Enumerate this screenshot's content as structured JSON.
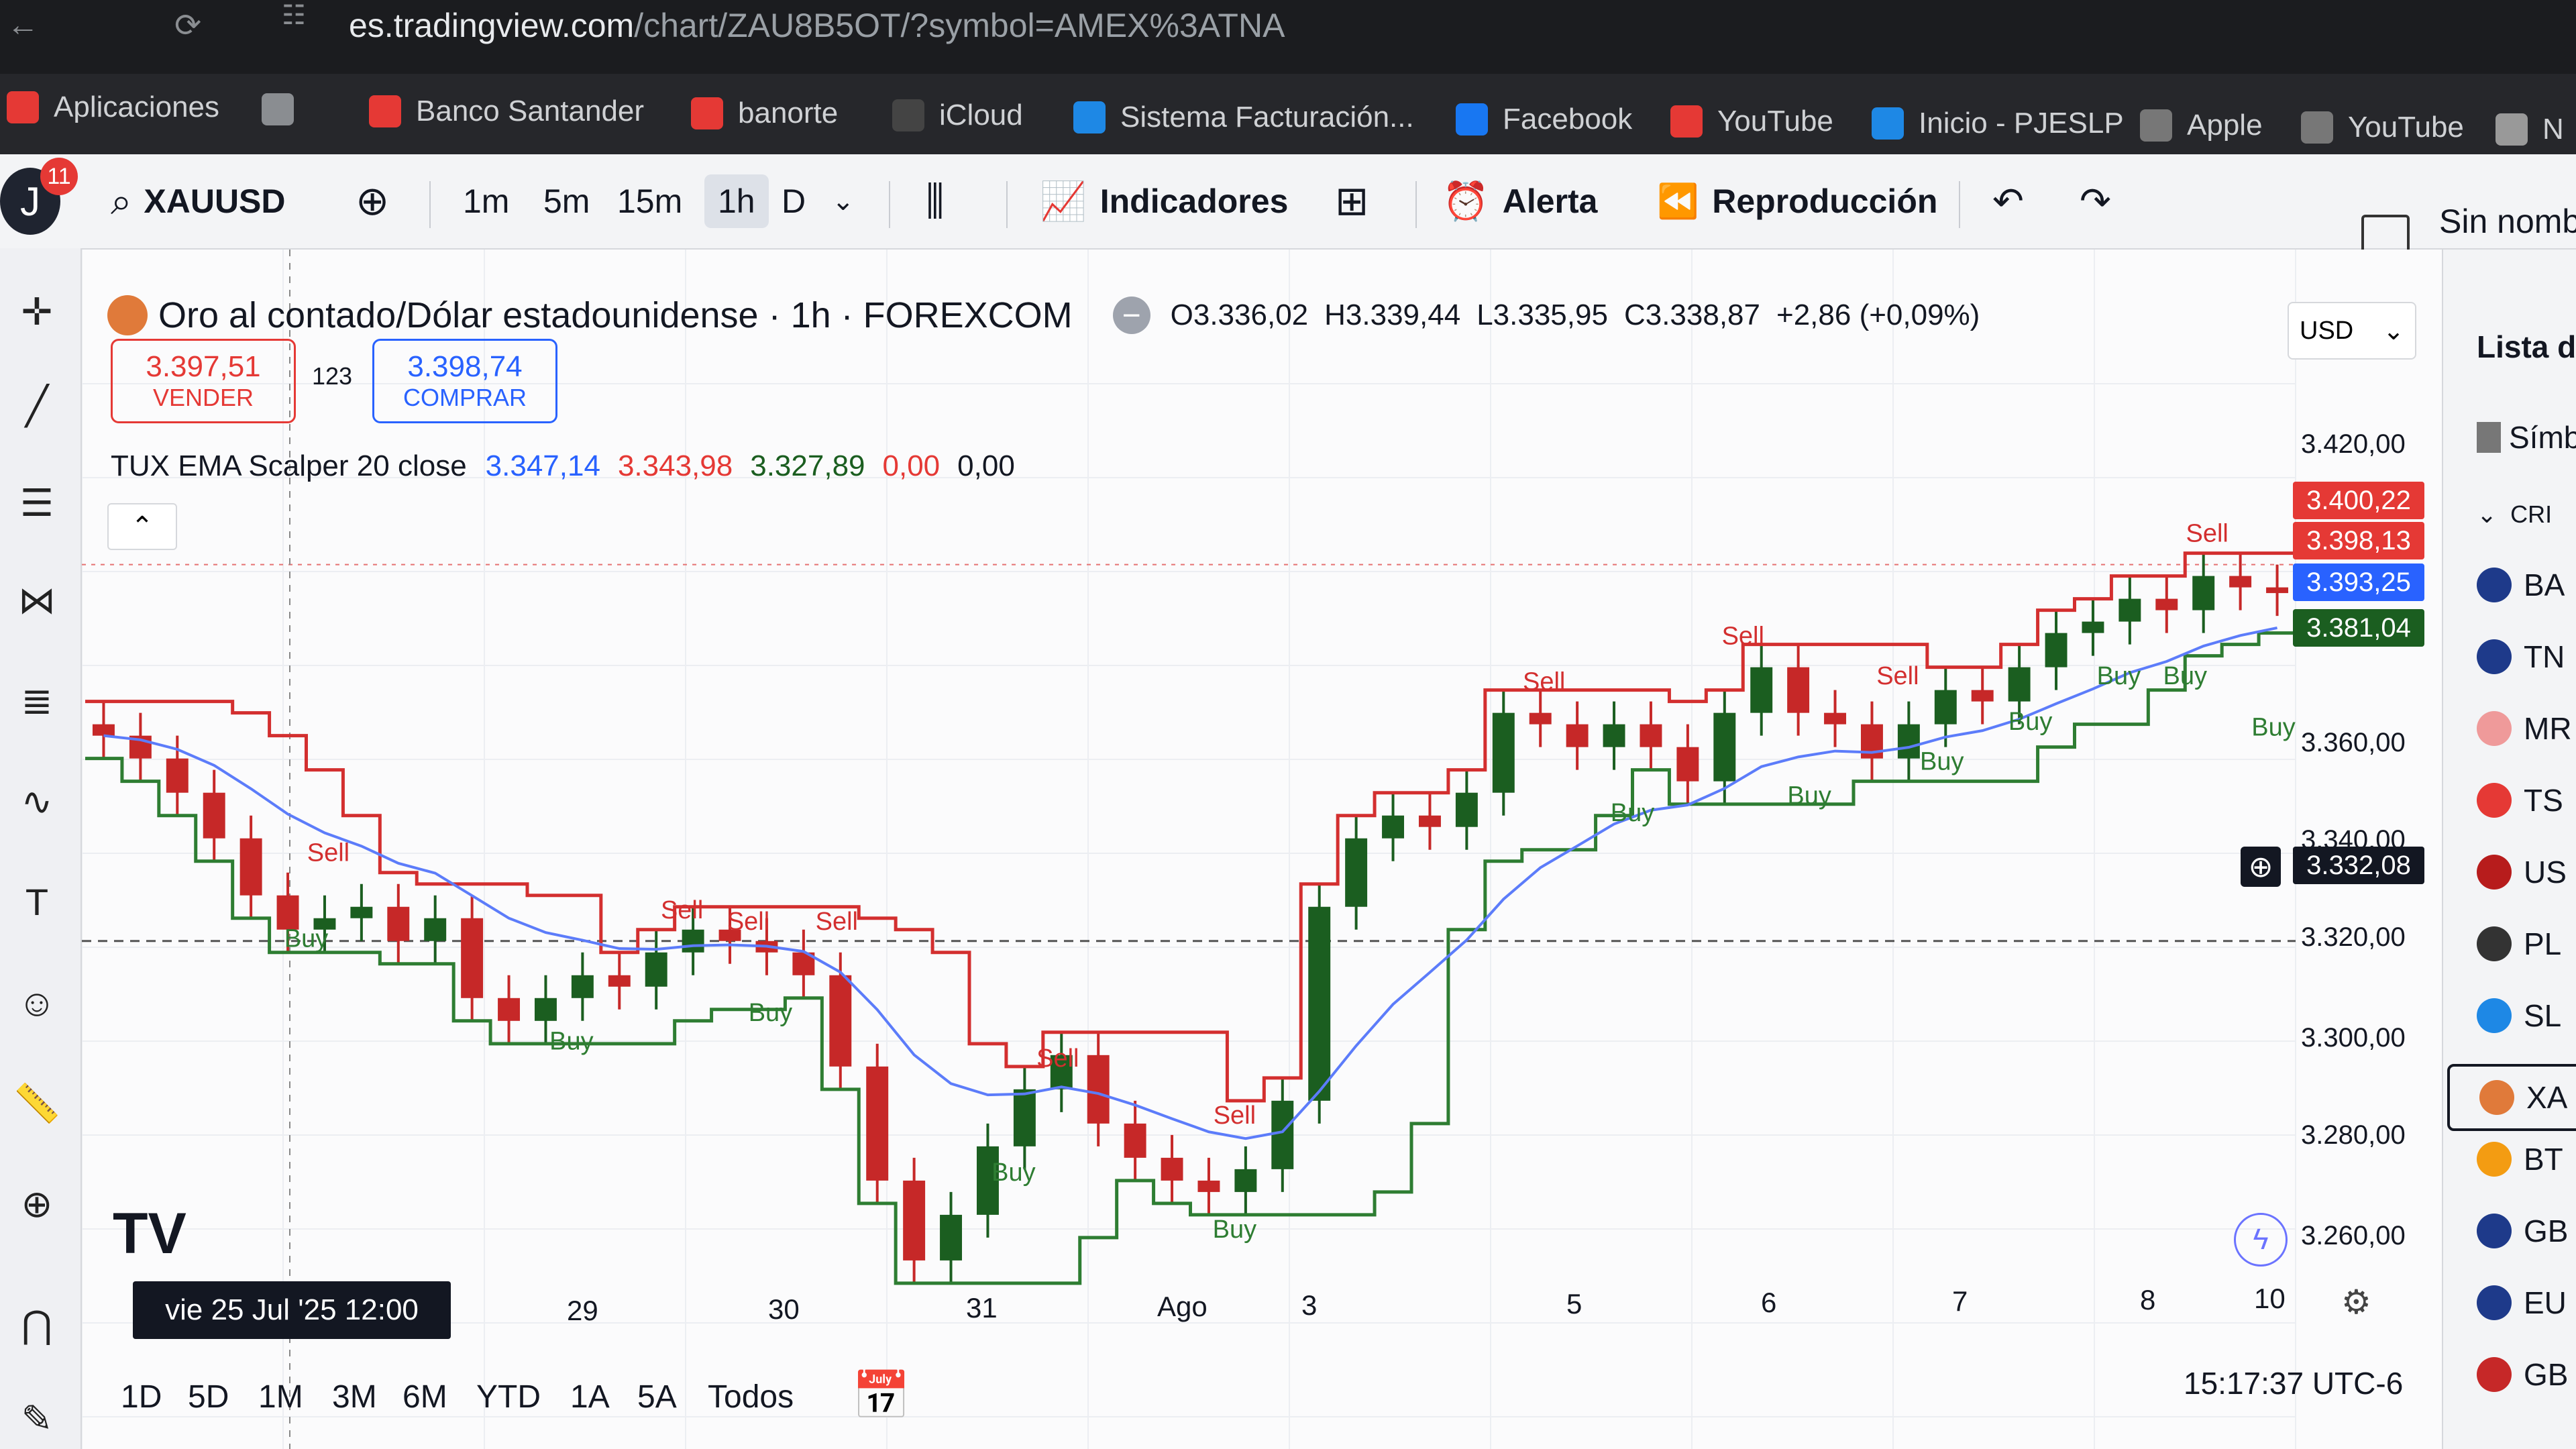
{
  "browser": {
    "url_host": "es.tradingview.com",
    "url_path": "/chart/ZAU8B5OT/?symbol=AMEX%3ATNA",
    "bookmarks": [
      {
        "label": "Aplicaciones",
        "icon": "apps-grid-icon",
        "color": "#e53935"
      },
      {
        "label": "",
        "icon": "grid-icon",
        "color": "#8a8d91"
      },
      {
        "label": "Banco Santander",
        "icon": "flame-icon",
        "color": "#e53935"
      },
      {
        "label": "banorte",
        "icon": "banorte-icon",
        "color": "#e53935"
      },
      {
        "label": "iCloud",
        "icon": "apple-icon",
        "color": "#444"
      },
      {
        "label": "Sistema Facturación...",
        "icon": "invoice-icon",
        "color": "#1e88e5"
      },
      {
        "label": "Facebook",
        "icon": "facebook-icon",
        "color": "#1877f2"
      },
      {
        "label": "YouTube",
        "icon": "youtube-icon",
        "color": "#e53935"
      },
      {
        "label": "Inicio - PJESLP",
        "icon": "building-icon",
        "color": "#1e88e5"
      },
      {
        "label": "Apple",
        "icon": "apple-icon",
        "color": "#777"
      },
      {
        "label": "YouTube",
        "icon": "globe-icon",
        "color": "#777"
      },
      {
        "label": "N",
        "icon": "folder-icon",
        "color": "#999"
      }
    ]
  },
  "toolbar": {
    "avatar_letter": "J",
    "notif_count": "11",
    "symbol": "XAUUSD",
    "intervals": [
      "1m",
      "5m",
      "15m",
      "1h",
      "D"
    ],
    "selected_interval": "1h",
    "indicators_label": "Indicadores",
    "alert_label": "Alerta",
    "replay_label": "Reproducción",
    "layout_name": "Sin nombr"
  },
  "legend": {
    "title": "Oro al contado/Dólar estadounidense · 1h · FOREXCOM",
    "open": "O3.336,02",
    "high": "H3.339,44",
    "low": "L3.335,95",
    "close": "C3.338,87",
    "change": "+2,86 (+0,09%)",
    "sell_price": "3.397,51",
    "sell_label": "VENDER",
    "spread": "123",
    "buy_price": "3.398,74",
    "buy_label": "COMPRAR",
    "currency": "USD"
  },
  "indicator": {
    "name": "TUX EMA Scalper 20 close",
    "v1": "3.347,14",
    "v2": "3.343,98",
    "v3": "3.327,89",
    "v4": "0,00",
    "v5": "0,00"
  },
  "price_axis": [
    "3.420,00",
    "3.360,00",
    "3.340,00",
    "3.320,00",
    "3.300,00",
    "3.280,00",
    "3.260,00"
  ],
  "price_tags": [
    {
      "label": "3.400,22",
      "color": "#e53935"
    },
    {
      "label": "3.398,13",
      "color": "#e53935"
    },
    {
      "label": "3.393,25",
      "color": "#2962ff"
    },
    {
      "label": "3.381,04",
      "color": "#1b5e20"
    },
    {
      "label": "3.332,08",
      "color": "#131722"
    }
  ],
  "time_axis": {
    "cursor_label": "vie 25 Jul '25   12:00",
    "ticks": [
      "29",
      "30",
      "31",
      "Ago",
      "3",
      "5",
      "6",
      "7",
      "8",
      "10"
    ]
  },
  "range_buttons": [
    "1D",
    "5D",
    "1M",
    "3M",
    "6M",
    "YTD",
    "1A",
    "5A",
    "Todos"
  ],
  "clock": "15:17:37 UTC-6",
  "watchlist": {
    "title": "Lista d",
    "col": "Símbol",
    "group": "CRI",
    "items": [
      {
        "label": "BA",
        "color": "#1e3a8a"
      },
      {
        "label": "TN",
        "color": "#1e3a8a"
      },
      {
        "label": "MR",
        "color": "#ef9a9a"
      },
      {
        "label": "TS",
        "color": "#e53935"
      },
      {
        "label": "US",
        "color": "#b71c1c"
      },
      {
        "label": "PL",
        "color": "#333"
      },
      {
        "label": "SL",
        "color": "#1e88e5"
      },
      {
        "label": "XA",
        "color": "#e07a3a"
      },
      {
        "label": "BT",
        "color": "#f39c12"
      },
      {
        "label": "GB",
        "color": "#1e3a8a"
      },
      {
        "label": "EU",
        "color": "#1e3a8a"
      },
      {
        "label": "GB",
        "color": "#c62828"
      }
    ]
  },
  "chart_data": {
    "type": "candlestick",
    "symbol": "XAUUSD",
    "interval": "1h",
    "ylim": [
      3250,
      3425
    ],
    "x": [
      "vie 25 Jul '25 12:00",
      "29",
      "30",
      "31",
      "Ago",
      "3",
      "5",
      "6",
      "7",
      "8",
      "10"
    ],
    "close_path": [
      3368,
      3364,
      3358,
      3350,
      3340,
      3334,
      3336,
      3338,
      3332,
      3336,
      3322,
      3318,
      3322,
      3326,
      3324,
      3330,
      3334,
      3332,
      3330,
      3326,
      3310,
      3290,
      3276,
      3284,
      3296,
      3306,
      3312,
      3300,
      3294,
      3290,
      3288,
      3292,
      3304,
      3338,
      3350,
      3354,
      3352,
      3358,
      3372,
      3370,
      3366,
      3370,
      3366,
      3360,
      3372,
      3380,
      3372,
      3370,
      3364,
      3370,
      3376,
      3374,
      3380,
      3386,
      3388,
      3392,
      3390,
      3396,
      3394,
      3393
    ],
    "signals": [
      {
        "label": "Sell",
        "x": 0.11,
        "y": 3346
      },
      {
        "label": "Buy",
        "x": 0.1,
        "y": 3331
      },
      {
        "label": "Sell",
        "x": 0.27,
        "y": 3336
      },
      {
        "label": "Sell",
        "x": 0.3,
        "y": 3334
      },
      {
        "label": "Sell",
        "x": 0.34,
        "y": 3334
      },
      {
        "label": "Buy",
        "x": 0.22,
        "y": 3313
      },
      {
        "label": "Buy",
        "x": 0.31,
        "y": 3318
      },
      {
        "label": "Sell",
        "x": 0.44,
        "y": 3310
      },
      {
        "label": "Buy",
        "x": 0.42,
        "y": 3290
      },
      {
        "label": "Sell",
        "x": 0.52,
        "y": 3300
      },
      {
        "label": "Buy",
        "x": 0.52,
        "y": 3280
      },
      {
        "label": "Sell",
        "x": 0.66,
        "y": 3376
      },
      {
        "label": "Buy",
        "x": 0.7,
        "y": 3353
      },
      {
        "label": "Sell",
        "x": 0.75,
        "y": 3384
      },
      {
        "label": "Buy",
        "x": 0.78,
        "y": 3356
      },
      {
        "label": "Sell",
        "x": 0.82,
        "y": 3377
      },
      {
        "label": "Buy",
        "x": 0.84,
        "y": 3362
      },
      {
        "label": "Buy",
        "x": 0.88,
        "y": 3369
      },
      {
        "label": "Sell",
        "x": 0.96,
        "y": 3402
      },
      {
        "label": "Buy",
        "x": 0.92,
        "y": 3377
      },
      {
        "label": "Buy",
        "x": 0.95,
        "y": 3377
      },
      {
        "label": "Buy",
        "x": 0.99,
        "y": 3368
      }
    ]
  }
}
